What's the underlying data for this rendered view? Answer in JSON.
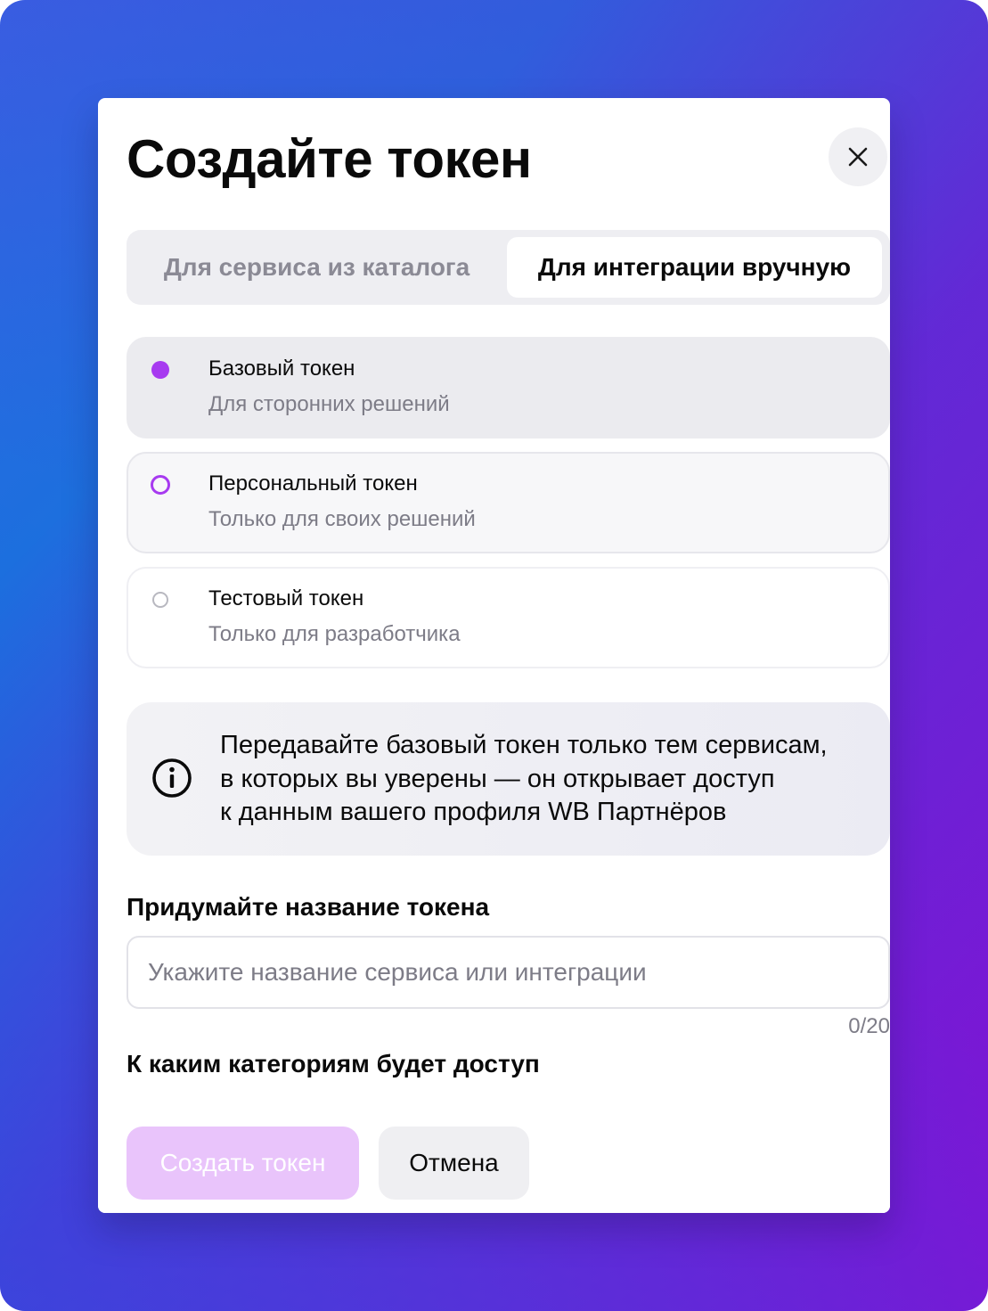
{
  "colors": {
    "accent": "#a73af0",
    "create_button_bg": "#e9c4fb",
    "text_primary": "#0a0a0a",
    "text_secondary": "#7d7c87"
  },
  "modal": {
    "title": "Создайте токен",
    "close_icon": "close-icon"
  },
  "tabs": [
    {
      "label": "Для сервиса из каталога",
      "active": false
    },
    {
      "label": "Для интеграции вручную",
      "active": true
    }
  ],
  "token_types": [
    {
      "title": "Базовый токен",
      "subtitle": "Для сторонних решений",
      "selected": true
    },
    {
      "title": "Персональный токен",
      "subtitle": "Только для своих решений",
      "selected": false
    },
    {
      "title": "Тестовый токен",
      "subtitle": "Только для разработчика",
      "selected": false
    }
  ],
  "notice": {
    "icon": "info-icon",
    "line1": "Передавайте базовый токен только тем сервисам,",
    "line2": "в которых вы уверены — он открывает доступ",
    "line3": "к данным вашего профиля WB Партнёров"
  },
  "name_field": {
    "label": "Придумайте название токена",
    "placeholder": "Укажите название сервиса или интеграции",
    "value": "",
    "counter": "0/20"
  },
  "categories": {
    "label": "К каким категориям будет доступ"
  },
  "actions": {
    "create_label": "Создать токен",
    "cancel_label": "Отмена"
  }
}
